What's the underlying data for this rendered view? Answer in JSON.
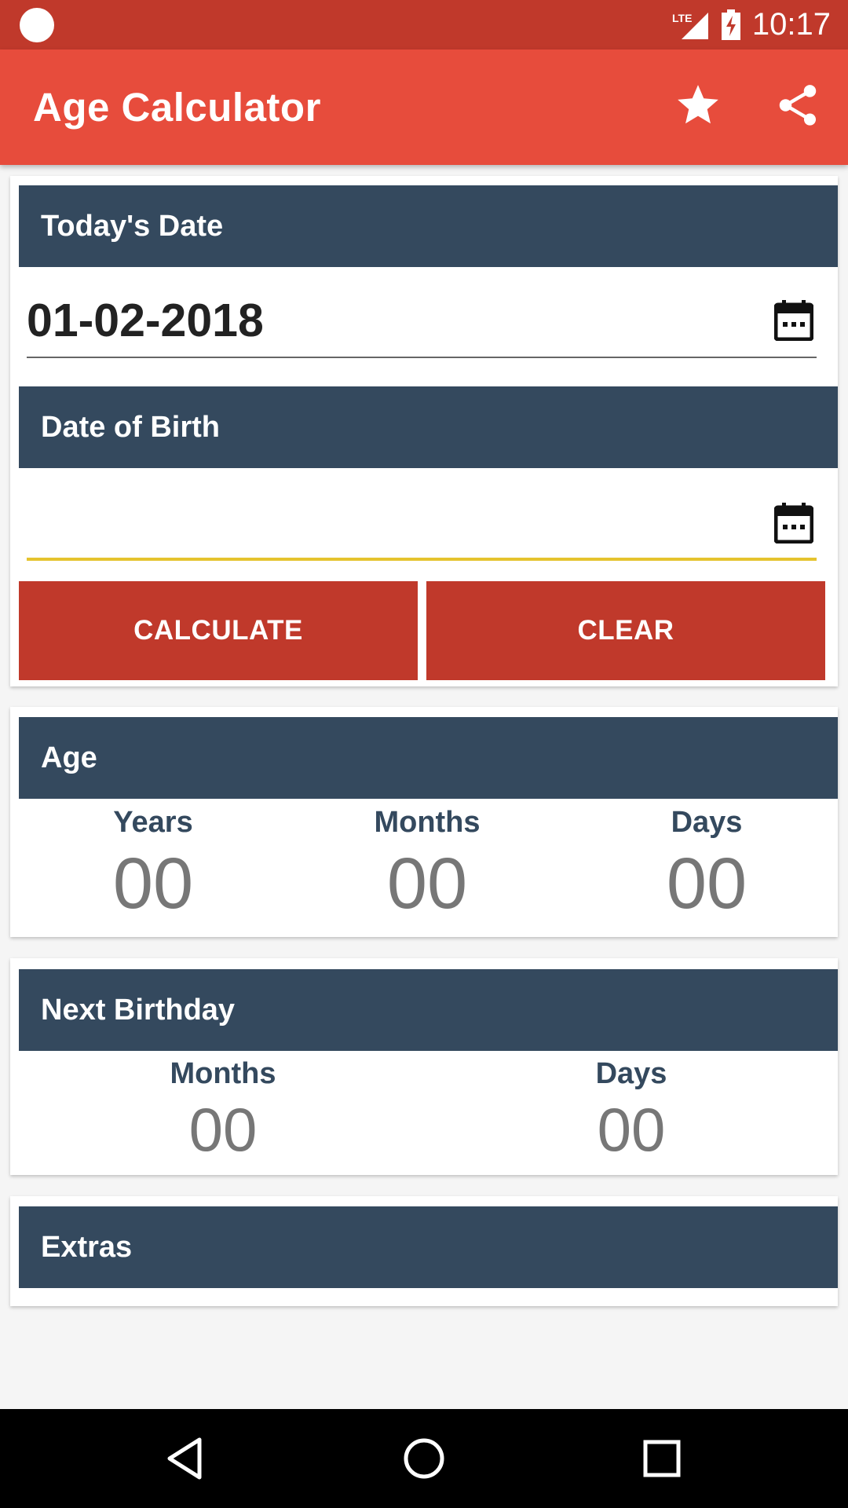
{
  "status_bar": {
    "time": "10:17",
    "network_label": "LTE",
    "icons": [
      "notification-dot-icon",
      "lte-signal-icon",
      "battery-charging-icon"
    ]
  },
  "app_bar": {
    "title": "Age Calculator",
    "actions": [
      "star-icon",
      "share-icon"
    ]
  },
  "input_card": {
    "todays_date_header": "Today's Date",
    "todays_date_value": "01-02-2018",
    "dob_header": "Date of Birth",
    "dob_value": "",
    "calculate_label": "CALCULATE",
    "clear_label": "CLEAR"
  },
  "age_card": {
    "header": "Age",
    "years_label": "Years",
    "years_value": "00",
    "months_label": "Months",
    "months_value": "00",
    "days_label": "Days",
    "days_value": "00"
  },
  "next_birthday_card": {
    "header": "Next Birthday",
    "months_label": "Months",
    "months_value": "00",
    "days_label": "Days",
    "days_value": "00"
  },
  "extras_card": {
    "header": "Extras"
  },
  "colors": {
    "status_bar": "#c0392b",
    "app_bar": "#e74c3c",
    "header": "#34495e",
    "button": "#c0392b",
    "focus_underline": "#e5c32e"
  },
  "nav_bar": {
    "icons": [
      "back-icon",
      "home-icon",
      "recents-icon"
    ]
  }
}
